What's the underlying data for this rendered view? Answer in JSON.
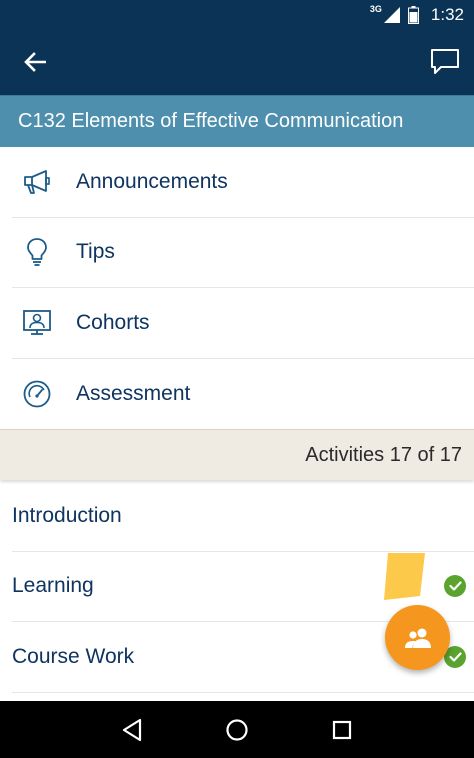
{
  "status_bar": {
    "network": "3G",
    "time": "1:32"
  },
  "app_bar": {
    "back_icon": "arrow-left-icon",
    "chat_icon": "chat-bubble-icon"
  },
  "course": {
    "title": "C132 Elements of Effective Communication"
  },
  "menu": {
    "items": [
      {
        "label": "Announcements",
        "icon": "megaphone-icon"
      },
      {
        "label": "Tips",
        "icon": "lightbulb-icon"
      },
      {
        "label": "Cohorts",
        "icon": "monitor-user-icon"
      },
      {
        "label": "Assessment",
        "icon": "gauge-icon"
      }
    ]
  },
  "activities": {
    "summary": "Activities 17 of 17",
    "items": [
      {
        "label": "Introduction",
        "completed": false
      },
      {
        "label": "Learning",
        "completed": true
      },
      {
        "label": "Course Work",
        "completed": true
      }
    ]
  },
  "colors": {
    "header": "#0a3355",
    "course_bar": "#4e8fae",
    "text": "#0f3460",
    "fab": "#f5961e",
    "check": "#5aa32f",
    "activities_bg": "#efebe2"
  }
}
